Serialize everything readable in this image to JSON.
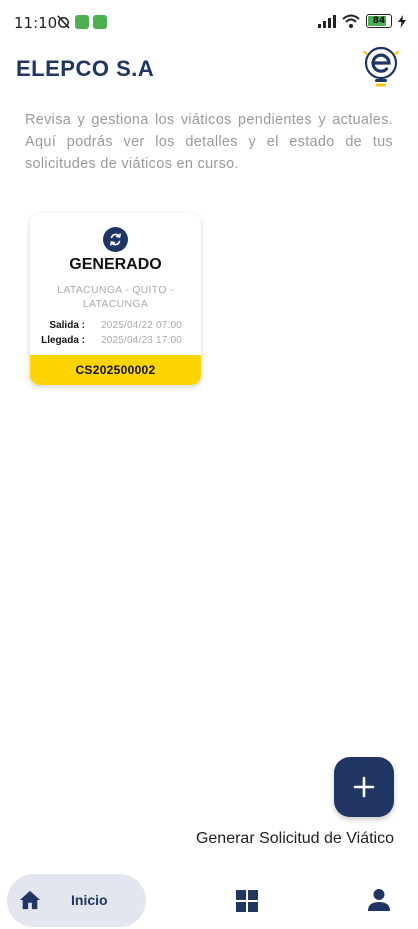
{
  "status_bar": {
    "time": "11:10",
    "battery_level": "84",
    "battery_fraction": 0.84,
    "icons": [
      "alarm-off-icon",
      "app-notification-icon",
      "app-notification-icon",
      "signal-icon",
      "wifi-icon",
      "battery-icon",
      "charging-icon"
    ]
  },
  "header": {
    "title": "ELEPCO S.A",
    "logo_icon": "lightbulb-e-logo-icon"
  },
  "intro": {
    "text": "Revisa y gestiona los viáticos pendientes y actuales. Aquí podrás ver los detalles y el estado de tus solicitudes de viáticos en curso."
  },
  "requests": [
    {
      "status_icon": "sync-icon",
      "status": "GENERADO",
      "route": "LATACUNGA - QUITO - LATACUNGA",
      "departure_label": "Salida :",
      "departure_value": "2025/04/22 07:00",
      "arrival_label": "Llegada :",
      "arrival_value": "2025/04/23 17:00",
      "code": "CS202500002"
    }
  ],
  "fab": {
    "icon": "plus-icon",
    "label": "Generar Solicitud de Viático"
  },
  "bottom_nav": {
    "items": [
      {
        "icon": "home-icon",
        "label": "Inicio",
        "active": true
      },
      {
        "icon": "grid-icon",
        "label": ""
      },
      {
        "icon": "person-icon",
        "label": ""
      }
    ]
  },
  "colors": {
    "primary": "#1f3563",
    "accent_yellow": "#fcd500",
    "text_muted": "#9a9a9a",
    "nav_active_bg": "#e3e6ee"
  }
}
